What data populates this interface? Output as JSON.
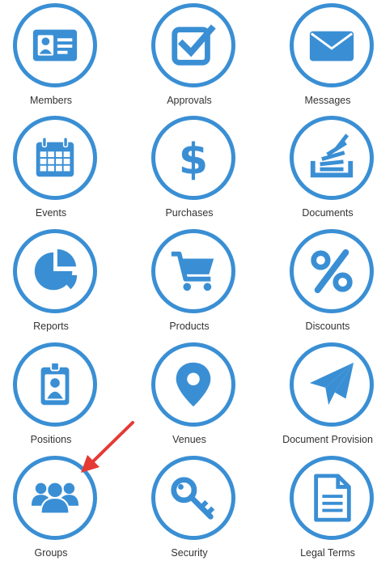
{
  "tiles": [
    {
      "label": "Members",
      "icon": "id-card-icon"
    },
    {
      "label": "Approvals",
      "icon": "checkbox-icon"
    },
    {
      "label": "Messages",
      "icon": "envelope-icon"
    },
    {
      "label": "Events",
      "icon": "calendar-icon"
    },
    {
      "label": "Purchases",
      "icon": "dollar-icon"
    },
    {
      "label": "Documents",
      "icon": "document-stack-icon"
    },
    {
      "label": "Reports",
      "icon": "pie-chart-icon"
    },
    {
      "label": "Products",
      "icon": "shopping-cart-icon"
    },
    {
      "label": "Discounts",
      "icon": "percent-icon"
    },
    {
      "label": "Positions",
      "icon": "badge-icon"
    },
    {
      "label": "Venues",
      "icon": "map-pin-icon"
    },
    {
      "label": "Document Provision",
      "icon": "paper-plane-icon"
    },
    {
      "label": "Groups",
      "icon": "users-icon"
    },
    {
      "label": "Security",
      "icon": "key-icon"
    },
    {
      "label": "Legal Terms",
      "icon": "file-text-icon"
    }
  ],
  "colors": {
    "accent": "#3a8fd4",
    "arrow": "#e53935",
    "label": "#333333"
  }
}
